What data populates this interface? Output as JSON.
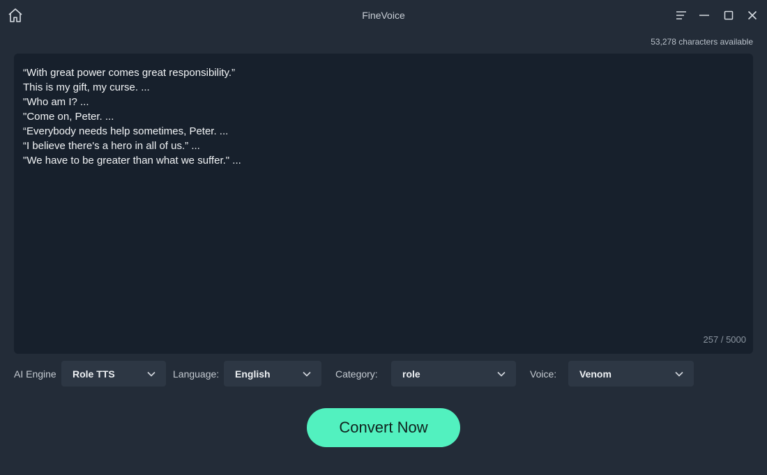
{
  "app": {
    "title": "FineVoice"
  },
  "header": {
    "characters_available": "53,278 characters available"
  },
  "editor": {
    "lines": [
      "“With great power comes great responsibility.”",
      "This is my gift, my curse. ...",
      "\"Who am I? ...",
      "\"Come on, Peter. ...",
      "“Everybody needs help sometimes, Peter. ...",
      "“I believe there's a hero in all of us.” ...",
      "\"We have to be greater than what we suffer.\" ..."
    ],
    "char_count": "257 / 5000"
  },
  "controls": {
    "ai_engine": {
      "label": "AI Engine",
      "value": "Role TTS"
    },
    "language": {
      "label": "Language:",
      "value": "English"
    },
    "category": {
      "label": "Category:",
      "value": "role"
    },
    "voice": {
      "label": "Voice:",
      "value": "Venom"
    }
  },
  "actions": {
    "convert_label": "Convert Now"
  },
  "colors": {
    "background": "#232c38",
    "editor": "#17202c",
    "accent": "#52f1bf",
    "select": "#2d3744"
  },
  "icons": {
    "home": "home-icon",
    "menu": "menu-icon",
    "minimize": "minimize-icon",
    "maximize": "maximize-icon",
    "close": "close-icon",
    "chevron": "chevron-down-icon"
  }
}
